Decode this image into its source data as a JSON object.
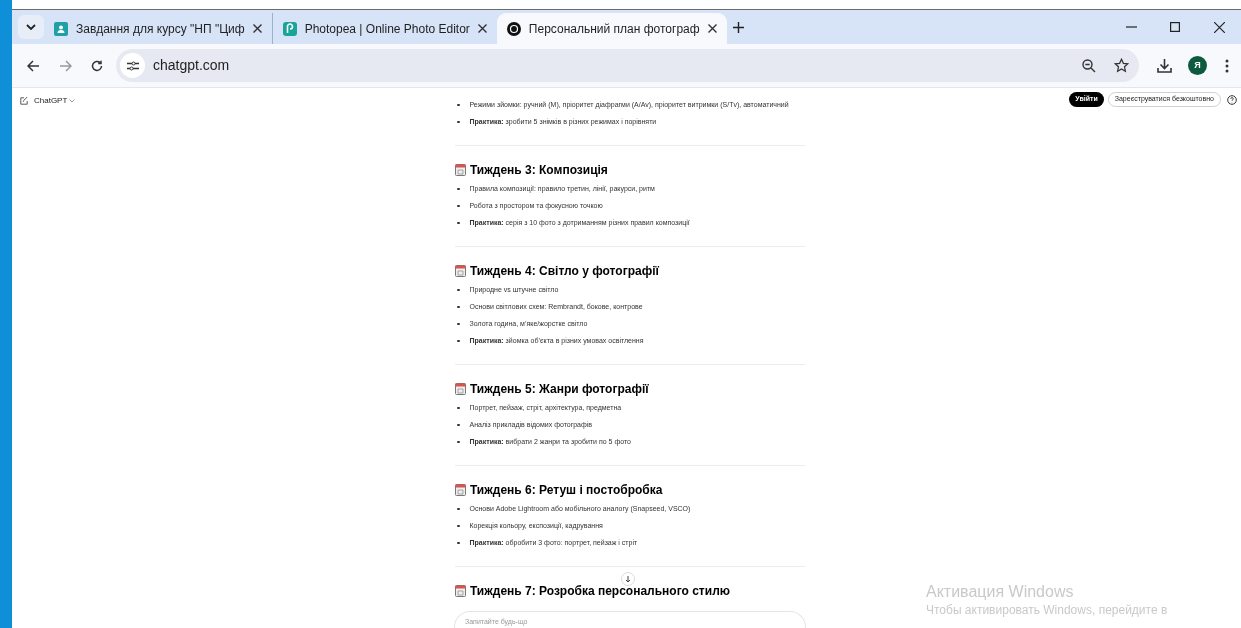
{
  "browser": {
    "tabs": [
      {
        "title": "Завдання для курсу \"НП \"Циф",
        "kind": "classroom",
        "selected": false
      },
      {
        "title": "Photopea | Online Photo Editor",
        "kind": "photopea",
        "selected": false
      },
      {
        "title": "Персональний план фотограф",
        "kind": "chatgpt",
        "selected": true
      }
    ],
    "url": "chatgpt.com",
    "avatar": "Я"
  },
  "page": {
    "model": "ChatGPT",
    "login": "Увійти",
    "signup": "Зареєструватися безкоштовно",
    "intro_items": [
      "Режими зйомки: ручний (M), пріоритет діафрагми (A/Av), пріоритет витримки (S/Tv), автоматичний",
      "**Практика:** зробити 5 знімків в різних режимах і порівняти"
    ],
    "weeks": [
      {
        "title": "Тиждень 3: Композиція",
        "items": [
          "Правила композиції: правило третин, лінії, ракурси, ритм",
          "Робота з простором та фокусною точкою",
          "**Практика:** серія з 10 фото з дотриманням різних правил композиції"
        ]
      },
      {
        "title": "Тиждень 4: Світло у фотографії",
        "items": [
          "Природне vs штучне світло",
          "Основи світлових схем: Rembrandt, бокове, контрове",
          "Золота година, м’яке/жорстке світло",
          "**Практика:** зйомка об’єкта в різних умовах освітлення"
        ]
      },
      {
        "title": "Тиждень 5: Жанри фотографії",
        "items": [
          "Портрет, пейзаж, стріт, архітектура, предметна",
          "Аналіз прикладів відомих фотографів",
          "**Практика:** вибрати 2 жанри та зробити по 5 фото"
        ]
      },
      {
        "title": "Тиждень 6: Ретуш і постобробка",
        "items": [
          "Основи Adobe Lightroom або мобільного аналогу (Snapseed, VSCO)",
          "Корекція кольору, експозиції, кадрування",
          "**Практика:** обробити 3 фото: портрет, пейзаж і стріт"
        ]
      },
      {
        "title": "Тиждень 7: Розробка персонального стилю"
      }
    ],
    "composer_placeholder": "Запитайте будь-що"
  },
  "os_notice": {
    "title": "Активация Windows",
    "text": "Чтобы активировать Windows, перейдите в"
  }
}
